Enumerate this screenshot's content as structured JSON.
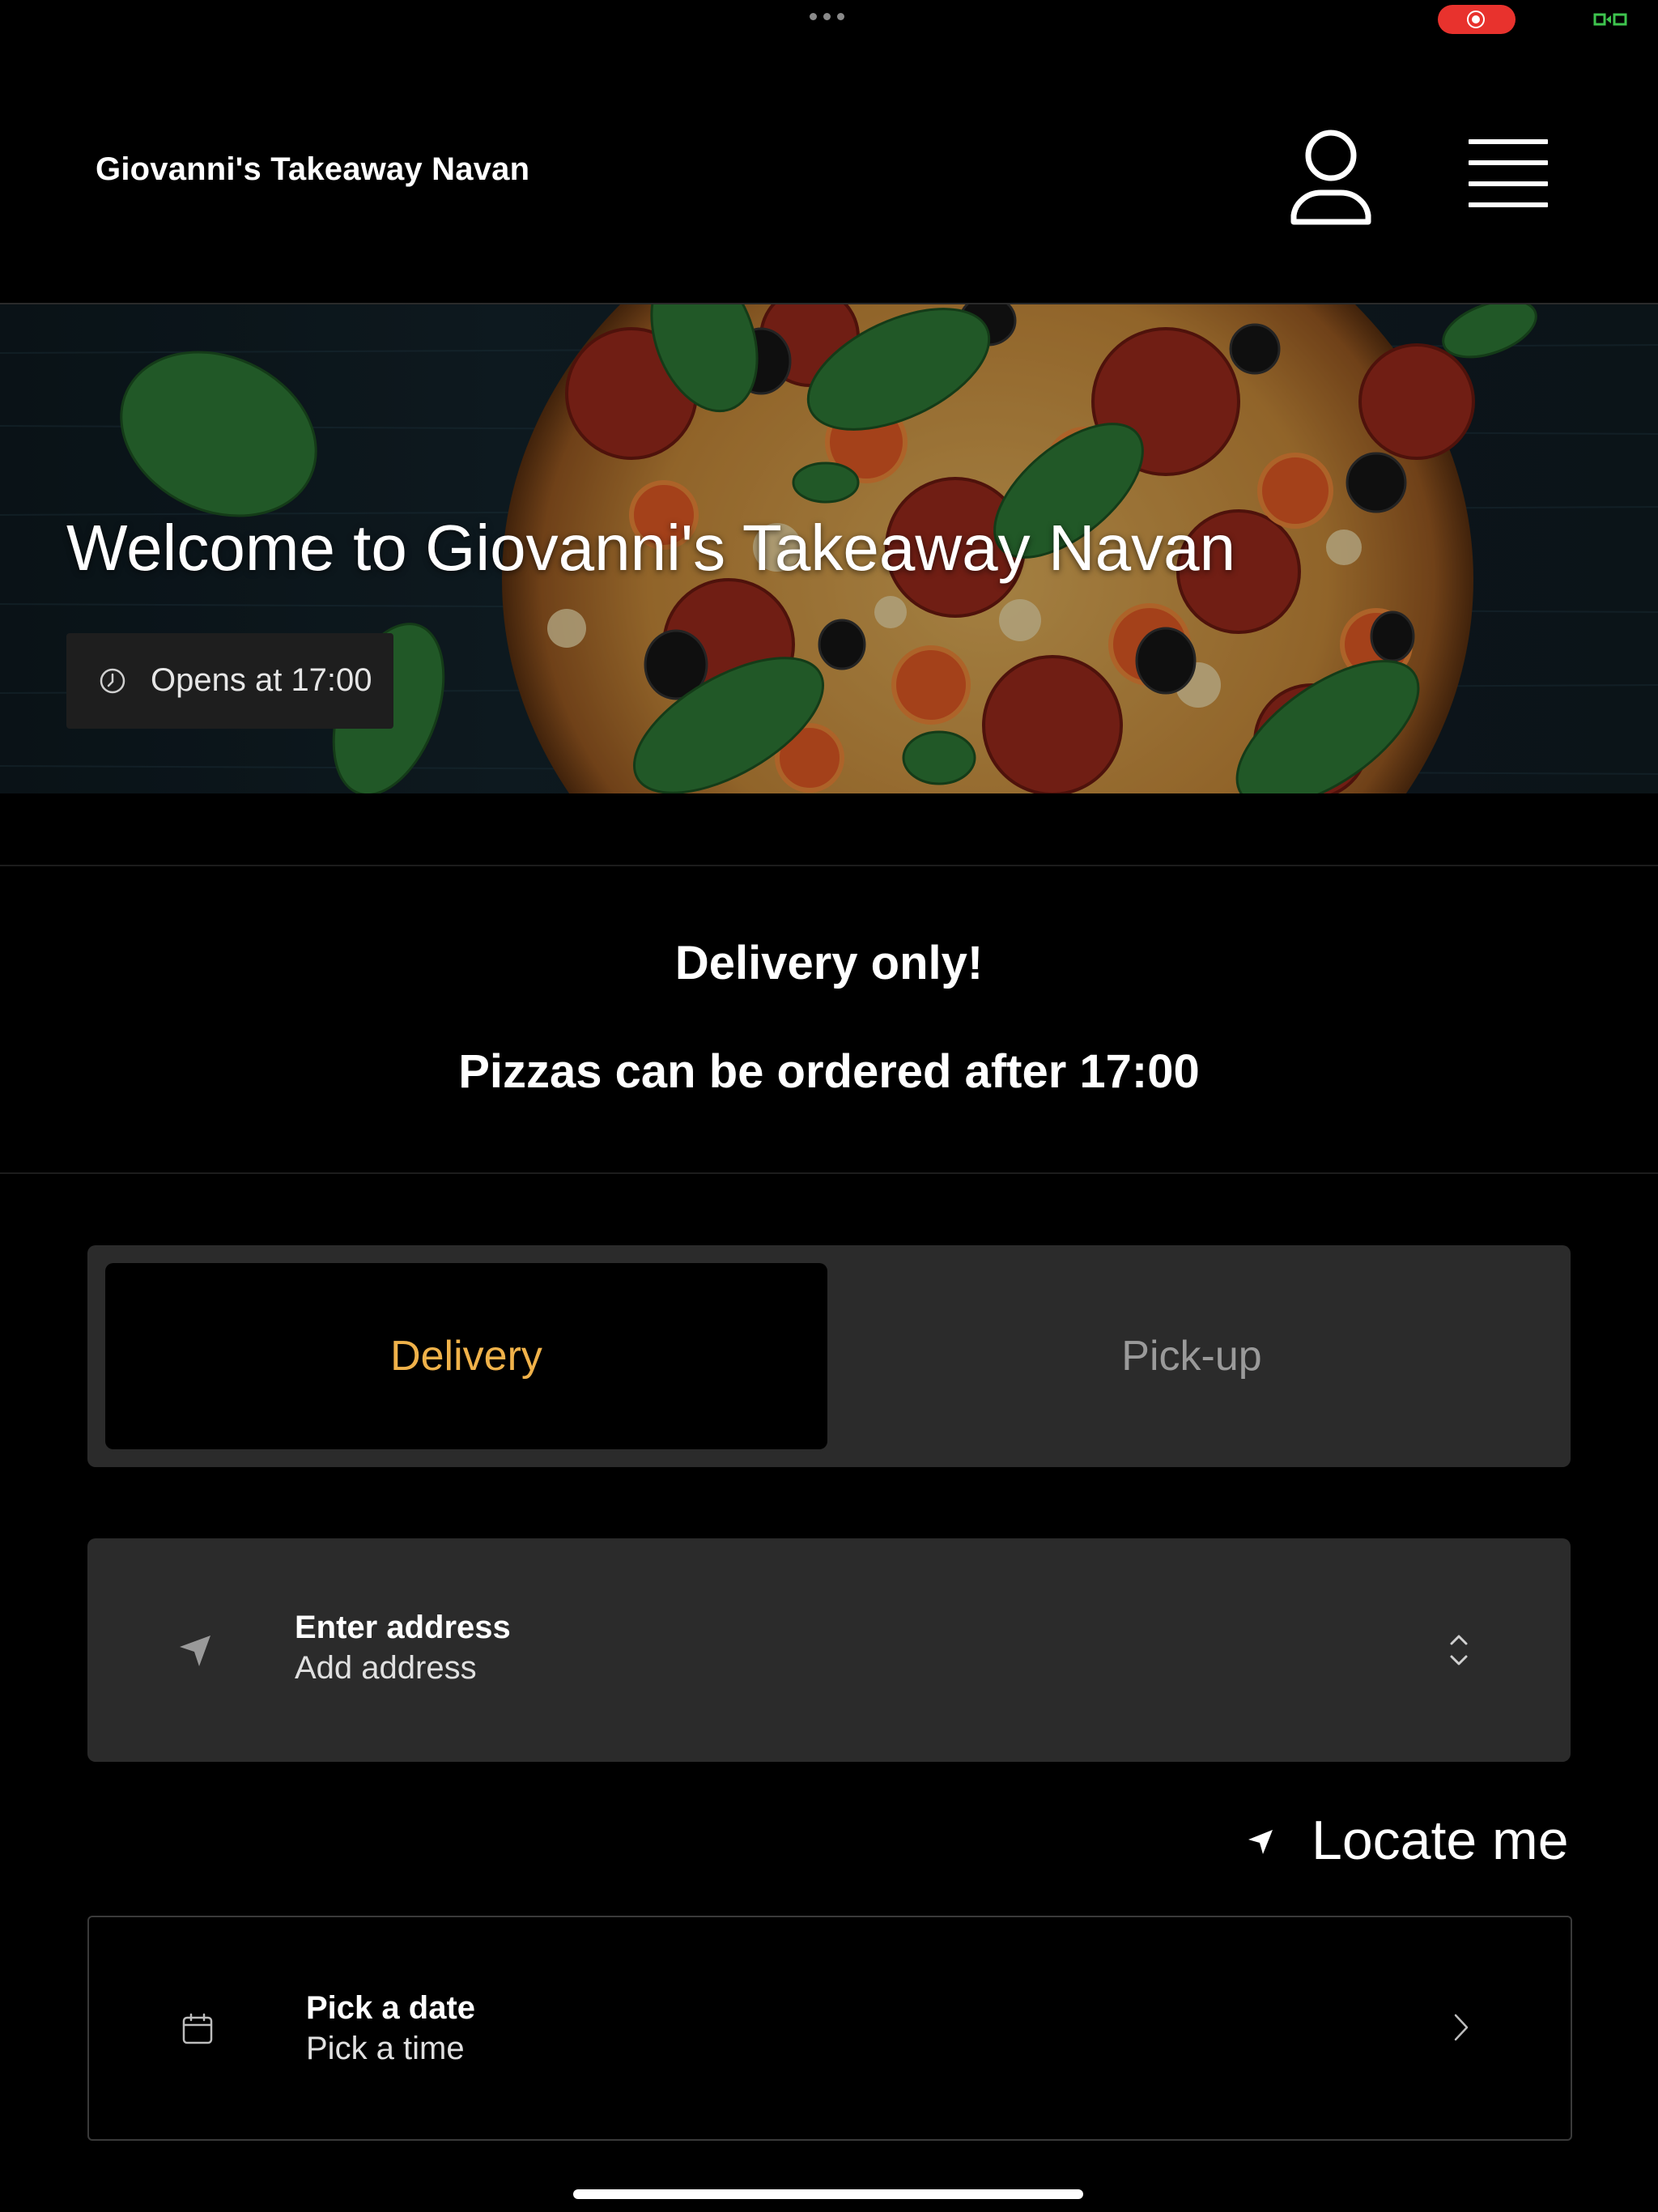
{
  "header": {
    "brand": "Giovanni's Takeaway Navan",
    "account_icon": "person-icon",
    "menu_icon": "hamburger-menu-icon"
  },
  "hero": {
    "title": "Welcome to Giovanni's Takeaway Navan",
    "hours": "Opens at 17:00",
    "hours_icon": "clock-icon"
  },
  "notice": {
    "line1": "Delivery only!",
    "line2": "Pizzas can be ordered after 17:00"
  },
  "order_mode": {
    "options": [
      "Delivery",
      "Pick-up"
    ],
    "selected": "Delivery"
  },
  "address": {
    "title": "Enter address",
    "subtitle": "Add address",
    "icon": "location-arrow-icon"
  },
  "locate": {
    "label": "Locate me",
    "icon": "location-arrow-icon"
  },
  "schedule": {
    "title": "Pick a date",
    "subtitle": "Pick a time",
    "icon": "calendar-icon"
  },
  "colors": {
    "accent": "#f0b24a",
    "background": "#000000",
    "card": "#2b2b2b",
    "recording": "#e8322d",
    "battery": "#3ec44e"
  }
}
